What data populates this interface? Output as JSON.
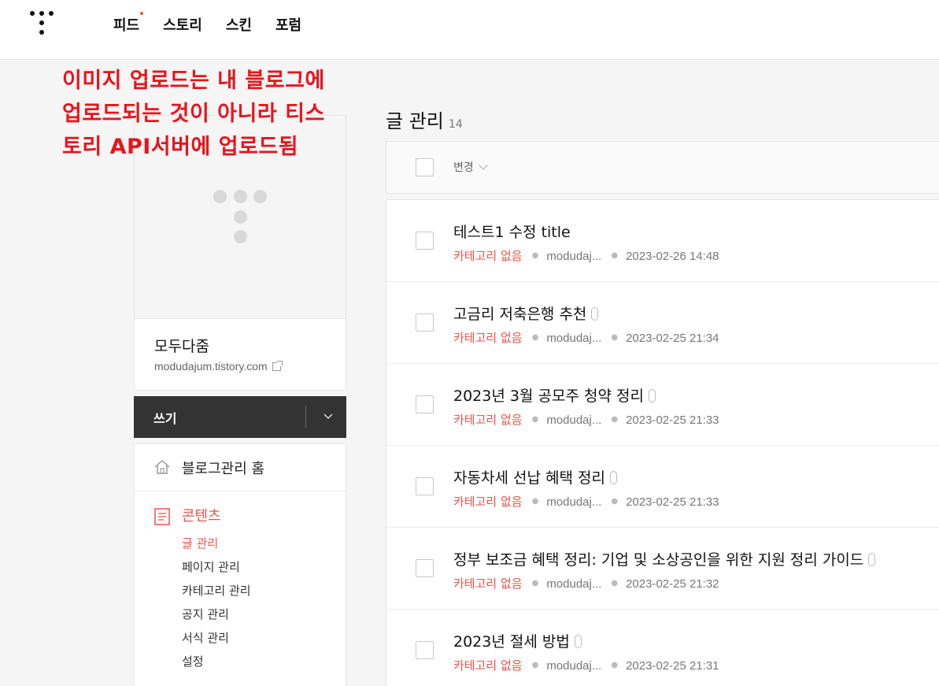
{
  "nav": {
    "items": [
      {
        "label": "피드",
        "has_dot": true
      },
      {
        "label": "스토리",
        "has_dot": false
      },
      {
        "label": "스킨",
        "has_dot": false
      },
      {
        "label": "포럼",
        "has_dot": false
      }
    ]
  },
  "annotation": {
    "line1": "이미지 업로드는 내 블로그에",
    "line2": "업로드되는 것이 아니라 티스",
    "line3": "토리 API서버에 업로드됨"
  },
  "profile": {
    "blog_name": "모두다줌",
    "blog_url": "modudajum.tistory.com"
  },
  "write_button": {
    "label": "쓰기"
  },
  "menu": {
    "home_label": "블로그관리 홈",
    "content_label": "콘텐츠",
    "sub_items": [
      "글 관리",
      "페이지 관리",
      "카테고리 관리",
      "공지 관리",
      "서식 관리",
      "설정"
    ]
  },
  "main": {
    "heading": "글 관리",
    "count": "14",
    "change_label": "변경"
  },
  "posts": [
    {
      "title": "테스트1 수정 title",
      "has_attachment": false,
      "category": "카테고리 없음",
      "author": "modudaj...",
      "date": "2023-02-26 14:48"
    },
    {
      "title": "고금리 저축은행 추천",
      "has_attachment": true,
      "category": "카테고리 없음",
      "author": "modudaj...",
      "date": "2023-02-25 21:34"
    },
    {
      "title": "2023년 3월 공모주 청약 정리",
      "has_attachment": true,
      "category": "카테고리 없음",
      "author": "modudaj...",
      "date": "2023-02-25 21:33"
    },
    {
      "title": "자동차세 선납 혜택 정리",
      "has_attachment": true,
      "category": "카테고리 없음",
      "author": "modudaj...",
      "date": "2023-02-25 21:33"
    },
    {
      "title": "정부 보조금 혜택 정리: 기업 및 소상공인을 위한 지원 정리 가이드",
      "has_attachment": true,
      "category": "카테고리 없음",
      "author": "modudaj...",
      "date": "2023-02-25 21:32"
    },
    {
      "title": "2023년 절세 방법",
      "has_attachment": true,
      "category": "카테고리 없음",
      "author": "modudaj...",
      "date": "2023-02-25 21:31"
    }
  ],
  "colors": {
    "accent": "#f0524a",
    "annotation": "#e8141b",
    "write_button_bg": "#333333"
  }
}
